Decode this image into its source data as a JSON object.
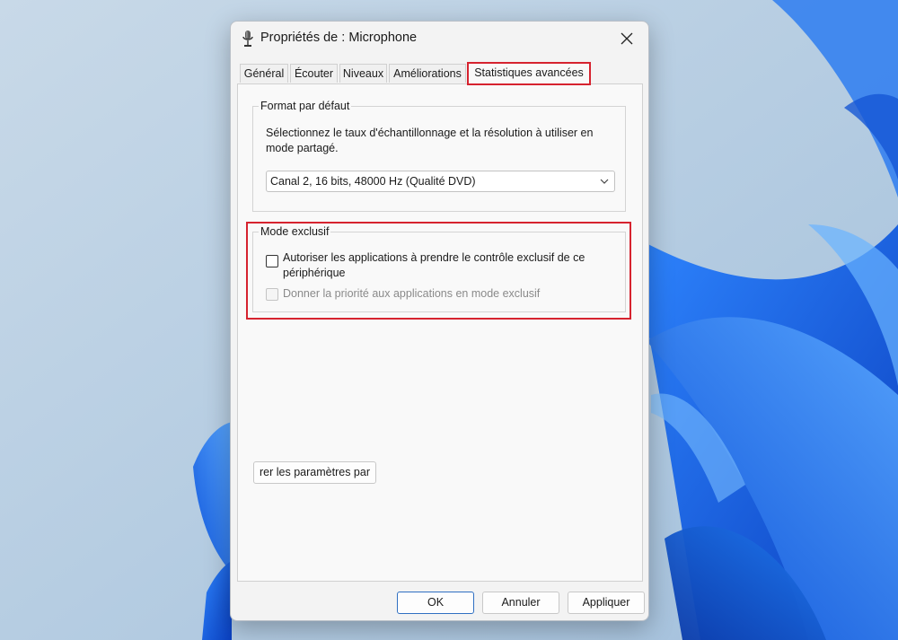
{
  "window": {
    "title": "Propriétés de : Microphone",
    "icon": "microphone-icon",
    "close_icon": "close-icon"
  },
  "tabs": [
    {
      "label": "Général",
      "active": false
    },
    {
      "label": "Écouter",
      "active": false
    },
    {
      "label": "Niveaux",
      "active": false
    },
    {
      "label": "Améliorations",
      "active": false
    },
    {
      "label": "Statistiques avancées",
      "active": true
    }
  ],
  "default_format": {
    "title": "Format par défaut",
    "description": "Sélectionnez le taux d'échantillonnage et la résolution à utiliser en mode partagé.",
    "selected_value": "Canal 2, 16 bits, 48000 Hz (Qualité DVD)",
    "dropdown_icon": "chevron-down-icon"
  },
  "exclusive_mode": {
    "title": "Mode exclusif",
    "allow_exclusive_label": "Autoriser les applications à prendre le contrôle exclusif de ce périphérique",
    "allow_exclusive_checked": false,
    "priority_label": "Donner la priorité aux applications en mode exclusif",
    "priority_checked": false,
    "priority_enabled": false
  },
  "restore_button_label": "rer les paramètres par",
  "buttons": {
    "ok": "OK",
    "cancel": "Annuler",
    "apply": "Appliquer"
  },
  "colors": {
    "highlight": "#d6232f",
    "dialog_bg": "#f3f3f3",
    "wallpaper_blue": "#1a6ee8"
  }
}
